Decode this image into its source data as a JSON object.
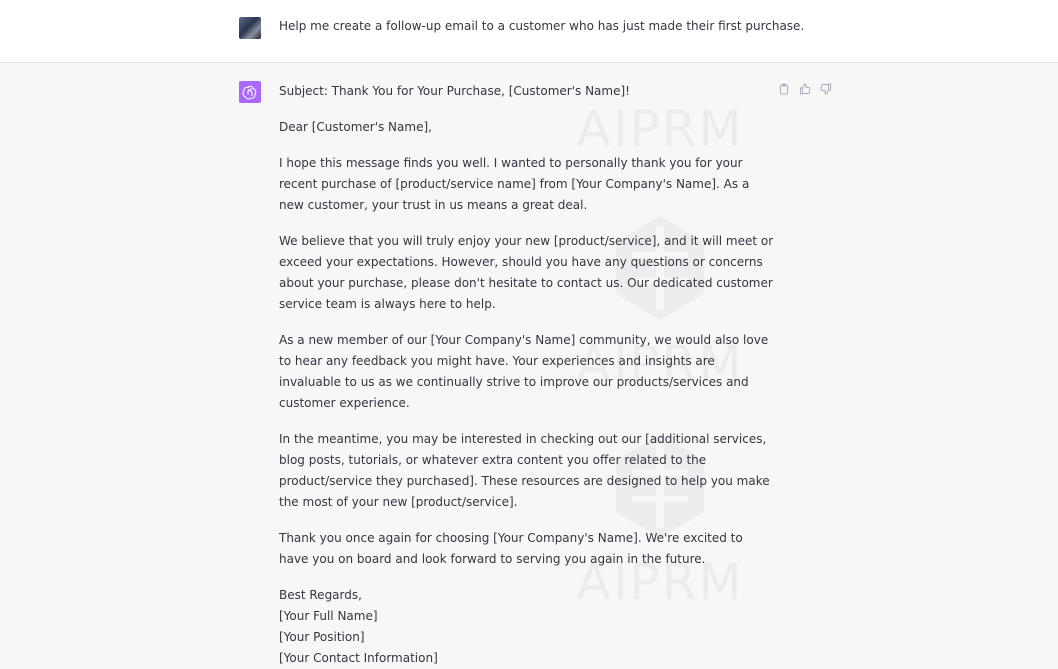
{
  "user_message": {
    "text": "Help me create a follow-up email to a customer who has just made their first purchase."
  },
  "assistant_message": {
    "subject": "Subject: Thank You for Your Purchase, [Customer's Name]!",
    "greeting": "Dear [Customer's Name],",
    "paragraphs": [
      "I hope this message finds you well. I wanted to personally thank you for your recent purchase of [product/service name] from [Your Company's Name]. As a new customer, your trust in us means a great deal.",
      "We believe that you will truly enjoy your new [product/service], and it will meet or exceed your expectations. However, should you have any questions or concerns about your purchase, please don't hesitate to contact us. Our dedicated customer service team is always here to help.",
      "As a new member of our [Your Company's Name] community, we would also love to hear any feedback you might have. Your experiences and insights are invaluable to us as we continually strive to improve our products/services and customer experience.",
      "In the meantime, you may be interested in checking out our [additional services, blog posts, tutorials, or whatever extra content you offer related to the product/service they purchased]. These resources are designed to help you make the most of your new [product/service].",
      "Thank you once again for choosing [Your Company's Name]. We're excited to have you on board and look forward to serving you again in the future."
    ],
    "signoff": [
      "Best Regards,",
      "[Your Full Name]",
      "[Your Position]",
      "[Your Contact Information]"
    ]
  },
  "watermark": {
    "text": "AIPRM"
  },
  "actions": {
    "copy_icon": "clipboard-icon",
    "like_icon": "thumbs-up-icon",
    "dislike_icon": "thumbs-down-icon"
  },
  "colors": {
    "assistant_icon_bg": "#ab68ff",
    "assistant_row_bg": "#f7f7f8",
    "text": "#343541"
  }
}
